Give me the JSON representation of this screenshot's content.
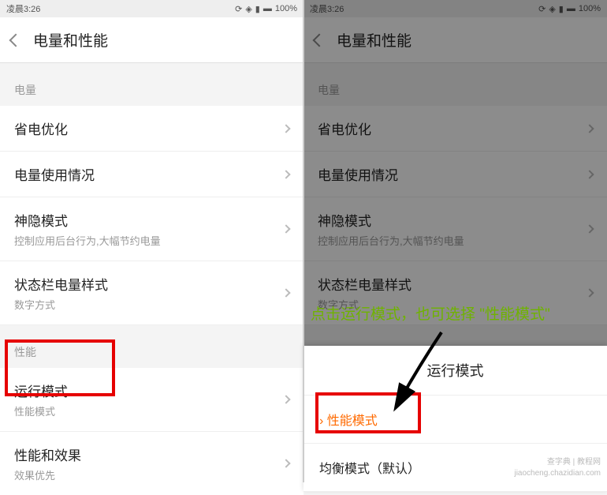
{
  "status": {
    "time": "凌晨3:26",
    "battery": "100%"
  },
  "header": {
    "title": "电量和性能"
  },
  "sections": {
    "battery_header": "电量",
    "performance_header": "性能"
  },
  "items": {
    "power_opt": {
      "label": "省电优化"
    },
    "usage": {
      "label": "电量使用情况"
    },
    "stealth": {
      "label": "神隐模式",
      "sub": "控制应用后台行为,大幅节约电量"
    },
    "status_style": {
      "label": "状态栏电量样式",
      "sub": "数字方式"
    },
    "run_mode": {
      "label": "运行模式",
      "sub": "性能模式"
    },
    "perf_effect": {
      "label": "性能和效果",
      "sub": "效果优先"
    }
  },
  "popup": {
    "title": "运行模式",
    "opt_perf": "性能模式",
    "opt_balanced": "均衡模式（默认）"
  },
  "annotation": "点击运行模式，也可选择 \"性能模式\"",
  "watermarks": {
    "w1": "查字典 | 教程网",
    "w2": "jiaocheng.chazidian.com"
  }
}
